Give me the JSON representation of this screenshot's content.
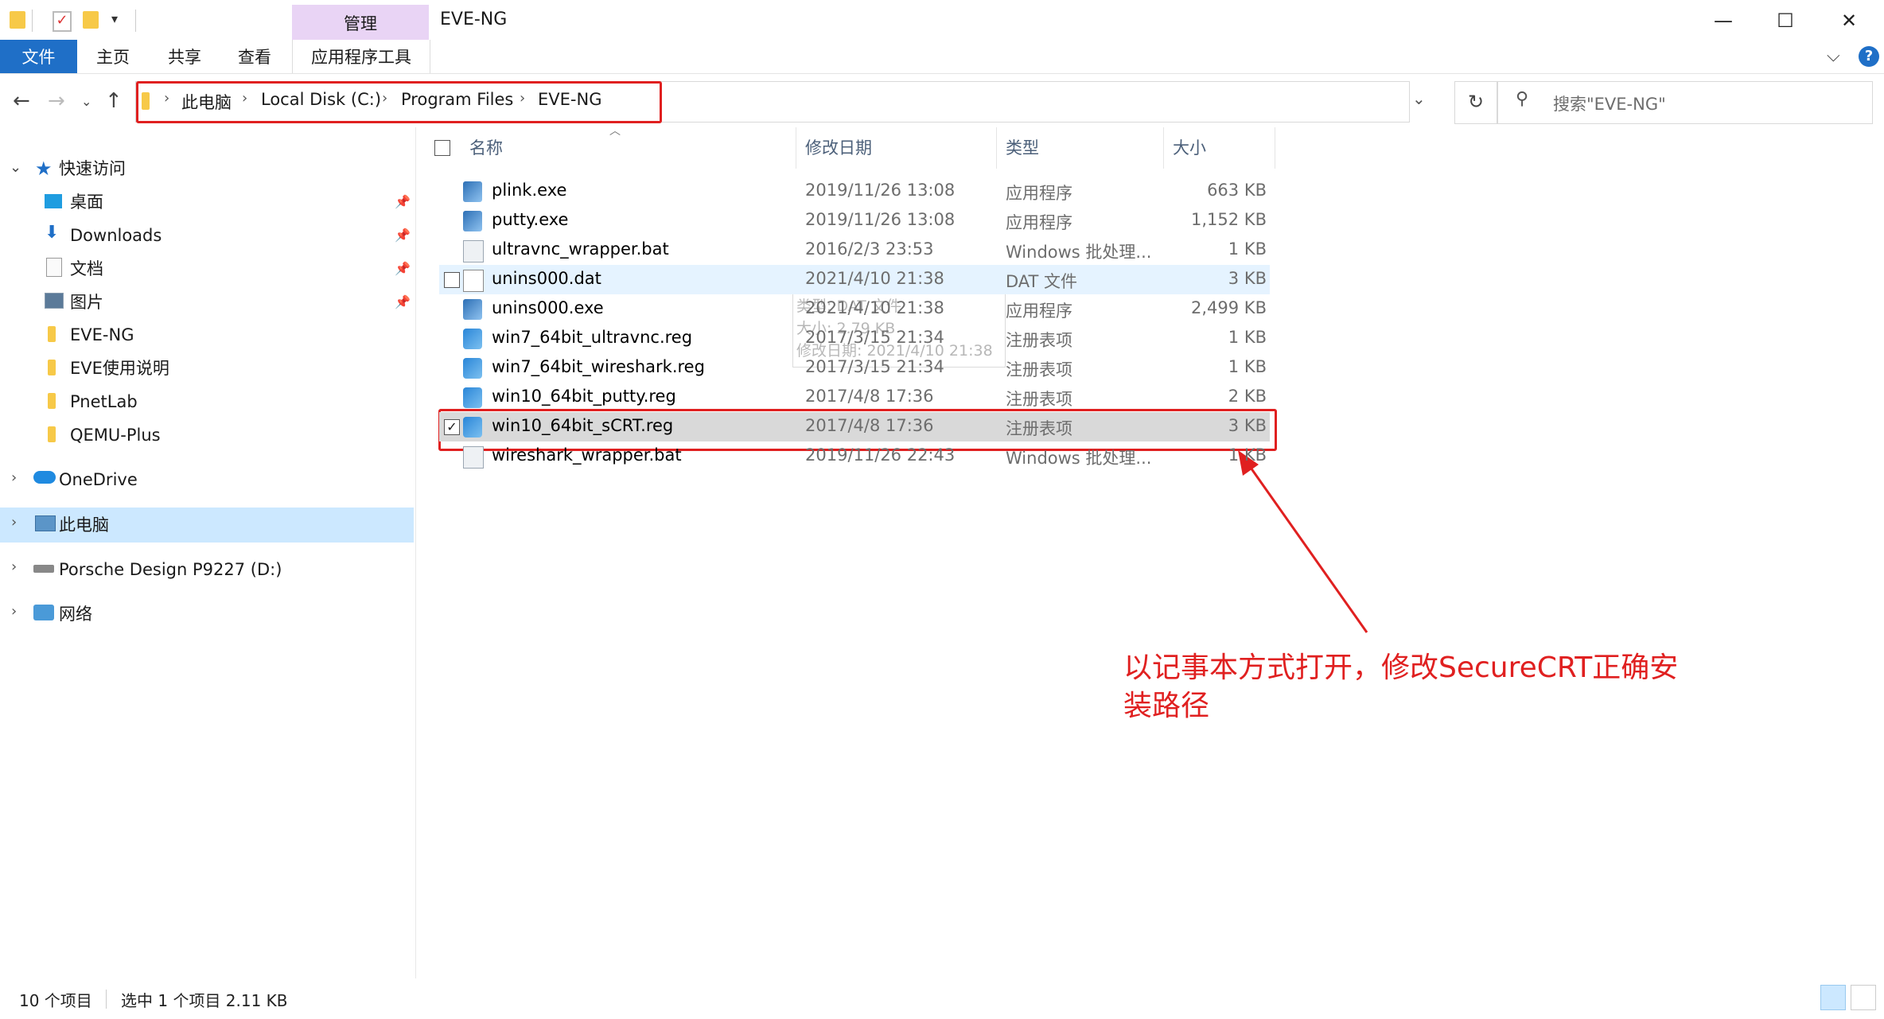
{
  "window": {
    "title": "EVE-NG",
    "context_tab_group": "管理",
    "minimize": "—",
    "maximize": "☐",
    "close": "✕"
  },
  "ribbon": {
    "file_tab": "文件",
    "tabs": [
      "主页",
      "共享",
      "查看"
    ],
    "context_tab": "应用程序工具"
  },
  "address": {
    "crumbs": [
      "此电脑",
      "Local Disk (C:)",
      "Program Files",
      "EVE-NG"
    ],
    "search_placeholder": "搜索\"EVE-NG\""
  },
  "nav": {
    "quick_access": "快速访问",
    "quick_items": [
      {
        "label": "桌面",
        "icon": "desktop-icon",
        "pinned": true
      },
      {
        "label": "Downloads",
        "icon": "download-arrow-icon",
        "pinned": true
      },
      {
        "label": "文档",
        "icon": "document-icon",
        "pinned": true
      },
      {
        "label": "图片",
        "icon": "pictures-icon",
        "pinned": true
      },
      {
        "label": "EVE-NG",
        "icon": "folder-icon",
        "pinned": false
      },
      {
        "label": "EVE使用说明",
        "icon": "folder-icon",
        "pinned": false
      },
      {
        "label": "PnetLab",
        "icon": "folder-icon",
        "pinned": false
      },
      {
        "label": "QEMU-Plus",
        "icon": "folder-icon",
        "pinned": false
      }
    ],
    "onedrive": "OneDrive",
    "this_pc": "此电脑",
    "drive": "Porsche Design P9227 (D:)",
    "network": "网络"
  },
  "columns": {
    "name": "名称",
    "date": "修改日期",
    "type": "类型",
    "size": "大小"
  },
  "files": [
    {
      "name": "plink.exe",
      "date": "2019/11/26 13:08",
      "type": "应用程序",
      "size": "663 KB",
      "icon": "exe-icon"
    },
    {
      "name": "putty.exe",
      "date": "2019/11/26 13:08",
      "type": "应用程序",
      "size": "1,152 KB",
      "icon": "exe-icon"
    },
    {
      "name": "ultravnc_wrapper.bat",
      "date": "2016/2/3 23:53",
      "type": "Windows 批处理...",
      "size": "1 KB",
      "icon": "bat-icon"
    },
    {
      "name": "unins000.dat",
      "date": "2021/4/10 21:38",
      "type": "DAT 文件",
      "size": "3 KB",
      "icon": "file-icon"
    },
    {
      "name": "unins000.exe",
      "date": "2021/4/10 21:38",
      "type": "应用程序",
      "size": "2,499 KB",
      "icon": "exe-icon"
    },
    {
      "name": "win7_64bit_ultravnc.reg",
      "date": "2017/3/15 21:34",
      "type": "注册表项",
      "size": "1 KB",
      "icon": "reg-icon"
    },
    {
      "name": "win7_64bit_wireshark.reg",
      "date": "2017/3/15 21:34",
      "type": "注册表项",
      "size": "1 KB",
      "icon": "reg-icon"
    },
    {
      "name": "win10_64bit_putty.reg",
      "date": "2017/4/8 17:36",
      "type": "注册表项",
      "size": "2 KB",
      "icon": "reg-icon"
    },
    {
      "name": "win10_64bit_sCRT.reg",
      "date": "2017/4/8 17:36",
      "type": "注册表项",
      "size": "3 KB",
      "icon": "reg-icon"
    },
    {
      "name": "wireshark_wrapper.bat",
      "date": "2019/11/26 22:43",
      "type": "Windows 批处理...",
      "size": "1 KB",
      "icon": "bat-icon"
    }
  ],
  "tooltip": {
    "line1": "类型: DAT 文件",
    "line2": "大小: 2.79 KB",
    "line3": "修改日期: 2021/4/10 21:38"
  },
  "annotation": {
    "line1": "以记事本方式打开，修改SecureCRT正确安",
    "line2": "装路径",
    "color": "#e02020"
  },
  "status": {
    "count": "10 个项目",
    "selection": "选中 1 个项目  2.11 KB"
  },
  "colors": {
    "accent": "#1f6fc7",
    "highlight": "#e02020",
    "selection": "#cce8ff"
  }
}
